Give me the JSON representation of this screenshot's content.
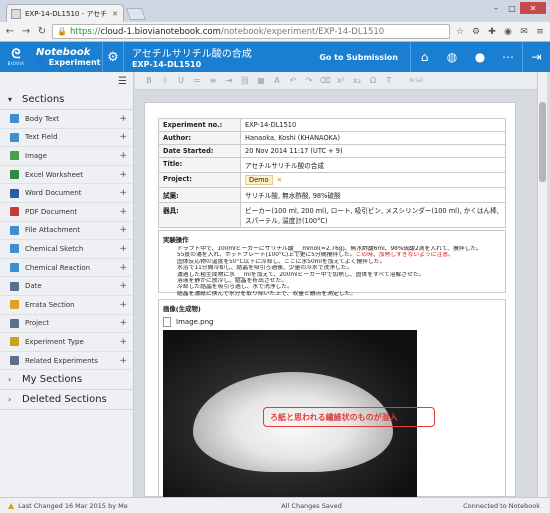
{
  "browser": {
    "tab_title": "EXP-14-DL1510 - アセチ",
    "url_https": "https://",
    "url_host": "cloud-1.biovianotebook.com",
    "url_path": "/notebook/experiment/EXP-14-DL1510"
  },
  "header": {
    "logo_text": "BIOVIA",
    "notebook_label": "Notebook",
    "experiment_label": "Experiment",
    "title": "アセチルサリチル酸の合成",
    "experiment_id": "EXP-14-DL1510",
    "goto_submission": "Go to Submission",
    "accent": "#1b7fd1"
  },
  "sidebar": {
    "sections_label": "Sections",
    "items": [
      {
        "label": "Body Text",
        "icon": "body-text-icon",
        "color": "#3d8fd1"
      },
      {
        "label": "Text Field",
        "icon": "text-field-icon",
        "color": "#3d8fd1"
      },
      {
        "label": "Image",
        "icon": "image-icon",
        "color": "#4aa04a"
      },
      {
        "label": "Excel Worksheet",
        "icon": "excel-icon",
        "color": "#2f8a3e"
      },
      {
        "label": "Word Document",
        "icon": "word-icon",
        "color": "#2b5ca8"
      },
      {
        "label": "PDF Document",
        "icon": "pdf-icon",
        "color": "#c93a3a"
      },
      {
        "label": "File Attachment",
        "icon": "attachment-icon",
        "color": "#3d8fd1"
      },
      {
        "label": "Chemical Sketch",
        "icon": "chemical-sketch-icon",
        "color": "#3d8fd1"
      },
      {
        "label": "Chemical Reaction",
        "icon": "chemical-reaction-icon",
        "color": "#3d8fd1"
      },
      {
        "label": "Date",
        "icon": "date-icon",
        "color": "#5a6f8a"
      },
      {
        "label": "Errata Section",
        "icon": "warning-icon",
        "color": "#e0a020"
      },
      {
        "label": "Project",
        "icon": "project-icon",
        "color": "#5a6f8a"
      },
      {
        "label": "Experiment Type",
        "icon": "tag-icon",
        "color": "#c9a21f"
      },
      {
        "label": "Related Experiments",
        "icon": "related-icon",
        "color": "#5a6f8a"
      }
    ],
    "my_sections_label": "My Sections",
    "deleted_sections_label": "Deleted Sections"
  },
  "toolbar": {
    "font_name": "Arial"
  },
  "info": {
    "rows": [
      {
        "key": "Experiment no.:",
        "value": "EXP-14-DL1510"
      },
      {
        "key": "Author:",
        "value": "Hanaoka, Koshi (KHANAOKA)"
      },
      {
        "key": "Date Started:",
        "value": "20 Nov 2014 11:17 (UTC + 9)"
      },
      {
        "key": "Title:",
        "value": "アセチルサリチル酸の合成"
      },
      {
        "key": "Project:",
        "value": "Demo"
      },
      {
        "key": "試薬:",
        "value": "サリチル酸, 無水酢酸, 98%硫酸"
      },
      {
        "key": "器具:",
        "value": "ビーカー(100 ml, 200 ml), ロート, 吸引ビン, メスシリンダー(100 ml), かくはん棒, スパーテル, 温度計(100°C)"
      }
    ]
  },
  "procedure": {
    "title": "実験操作",
    "steps": [
      "ドラフト中で、100mlビーカーにサリチル酸___mmol(=2.76g)、無水酢酸6ml、98%硫酸2滴を入れて、攪拌した。",
      "55度の湯を入れ、ホットプレート(100°C)上で更に5分間攪拌した。",
      "固体反応物の温度を50°C以下に冷却し、ここに水50mlを加えてよく攪拌した。",
      "水浴で11分間冷却し、結晶を吸引ろ過後、少量の冷水で洗浄した。",
      "濾過した粗生成物に水___mlを加えて、200mlビーカー中で加熱し、固体をすべて溶解させた。",
      "溶液を静かに放冷し、結晶を析出させた。",
      "冷却した結晶を吸引ろ過し、水で洗浄した。",
      "結晶を濾紙に挟んで水分を取り除いた上で、収量と融点を測定した。"
    ],
    "note_red": "この時、加熱しすぎないように注意。"
  },
  "image_section": {
    "title": "画像(生成物)",
    "filename": "Image.png",
    "callout": "ろ紙と思われる繊維状のものが混入"
  },
  "status": {
    "last_changed": "Last Changed 16 Mar 2015 by Me",
    "saved": "All Changes Saved",
    "connection": "Connected to Notebook"
  }
}
